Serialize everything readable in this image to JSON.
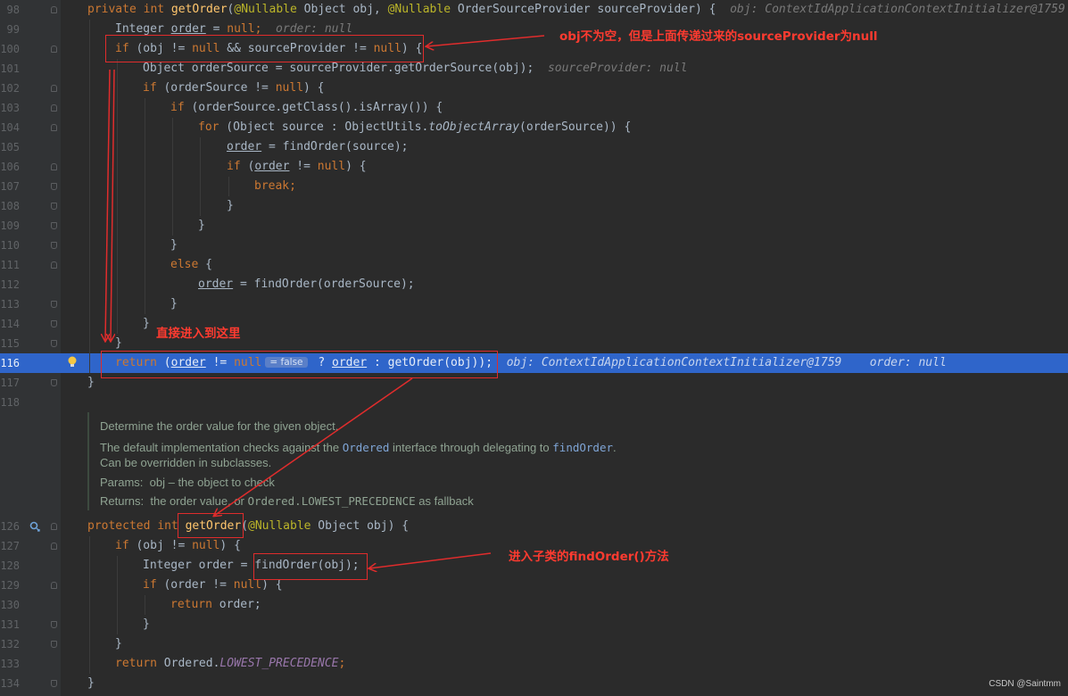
{
  "line_numbers": [
    "98",
    "99",
    "100",
    "101",
    "102",
    "103",
    "104",
    "105",
    "106",
    "107",
    "108",
    "109",
    "110",
    "111",
    "112",
    "113",
    "114",
    "115",
    "116",
    "117",
    "118",
    "126",
    "127",
    "128",
    "129",
    "130",
    "131",
    "132",
    "133",
    "134"
  ],
  "code": {
    "l98": {
      "kw1": "private int ",
      "fn": "getOrder",
      "p1": "(",
      "an1": "@Nullable",
      "p2": " Object obj, ",
      "an2": "@Nullable",
      "p3": " OrderSourceProvider sourceProvider) {",
      "hint": "obj: ContextIdApplicationContextInitializer@1759"
    },
    "l99": {
      "t1": "Integer ",
      "v": "order",
      "t2": " = ",
      "kw": "null",
      "t3": ";",
      "hint": "order: null"
    },
    "l100": {
      "kw1": "if",
      "t1": " (obj != ",
      "kw2": "null",
      "t2": " && sourceProvider != ",
      "kw3": "null",
      "t3": ") {"
    },
    "l101": {
      "t1": "Object orderSource = sourceProvider.getOrderSource(obj);",
      "hint": "sourceProvider: null"
    },
    "l102": {
      "kw1": "if",
      "t1": " (orderSource != ",
      "kw2": "null",
      "t2": ") {"
    },
    "l103": {
      "kw1": "if",
      "t1": " (orderSource.getClass().isArray()) {"
    },
    "l104": {
      "kw1": "for",
      "t1": " (Object source : ObjectUtils.",
      "it": "toObjectArray",
      "t2": "(orderSource)) {"
    },
    "l105": {
      "v": "order",
      "t1": " = findOrder(source);"
    },
    "l106": {
      "kw1": "if",
      "t1": " (",
      "v": "order",
      "t2": " != ",
      "kw2": "null",
      "t3": ") {"
    },
    "l107": {
      "kw1": "break",
      "t1": ";"
    },
    "l108": {
      "t1": "}"
    },
    "l109": {
      "t1": "}"
    },
    "l110": {
      "t1": "}"
    },
    "l111": {
      "kw1": "else",
      "t1": " {"
    },
    "l112": {
      "v": "order",
      "t1": " = findOrder(orderSource);"
    },
    "l113": {
      "t1": "}"
    },
    "l114": {
      "t1": "}"
    },
    "l115": {
      "t1": "}"
    },
    "l116": {
      "kw1": "return",
      "t1": " (",
      "v1": "order",
      "t2": " != ",
      "kw2": "null",
      "chip": "= false",
      "t3": " ? ",
      "v2": "order",
      "t4": " : getOrder(obj));",
      "hint1": "obj: ContextIdApplicationContextInitializer@1759",
      "hint2": "order: null"
    },
    "l117": {
      "t1": "}"
    },
    "l126": {
      "kw1": "protected int ",
      "fn": "getOrder",
      "an": "@Nullable",
      "t1": " Object obj) {",
      "p0": "("
    },
    "l127": {
      "kw1": "if",
      "t1": " (obj != ",
      "kw2": "null",
      "t2": ") {"
    },
    "l128": {
      "t1": "Integer order = ",
      "t2": "findOrder(obj);"
    },
    "l129": {
      "kw1": "if",
      "t1": " (order != ",
      "kw2": "null",
      "t2": ") {"
    },
    "l130": {
      "kw1": "return",
      "t1": " order;"
    },
    "l131": {
      "t1": "}"
    },
    "l132": {
      "t1": "}"
    },
    "l133": {
      "kw1": "return",
      "t1": " Ordered.",
      "st": "LOWEST_PRECEDENCE",
      "t2": ";"
    },
    "l134": {
      "t1": "}"
    }
  },
  "javadoc": {
    "line1": "Determine the order value for the given object.",
    "line2a": "The default implementation checks against the ",
    "line2b": "Ordered",
    "line2c": " interface through delegating to ",
    "line2d": "findOrder",
    "line2e": ".",
    "line3": "Can be overridden in subclasses.",
    "params_label": "Params:",
    "params_text": "obj – the object to check",
    "returns_label": "Returns:",
    "returns_a": "the order value, or ",
    "returns_b": "Ordered.LOWEST_PRECEDENCE",
    "returns_c": " as fallback"
  },
  "annotations": {
    "note1": "obj不为空，但是上面传递过来的sourceProvider为null",
    "note2": "直接进入到这里",
    "note3": "进入子类的findOrder()方法"
  },
  "watermark": "CSDN @Saintmm",
  "colors": {
    "exec_line": "#2f65ca",
    "annotation": "#e02c2c",
    "keyword": "#cc7832",
    "method": "#ffc66d"
  }
}
